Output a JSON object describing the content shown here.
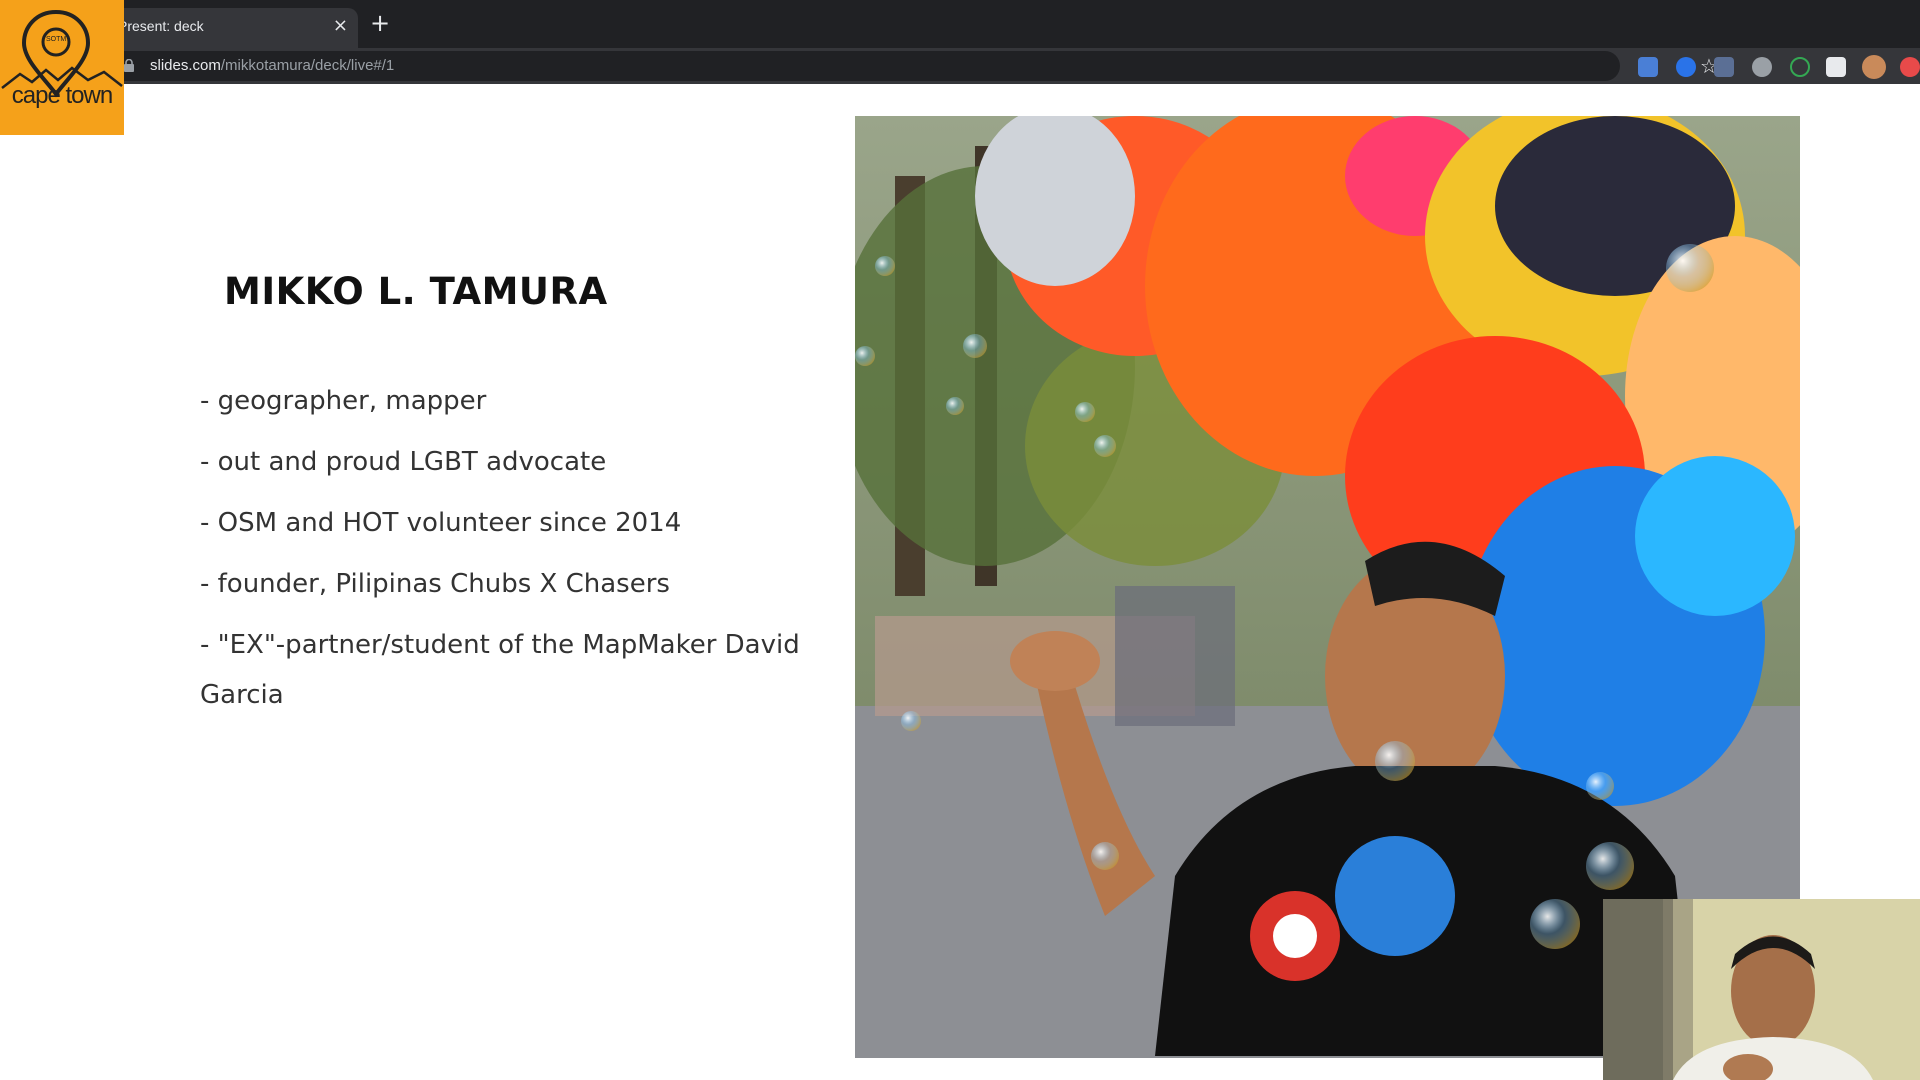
{
  "browser": {
    "tab_title": "Present: deck",
    "tab_close": "×",
    "new_tab": "+",
    "url_domain": "slides.com",
    "url_path": "/mikkotamura/deck/live#/1",
    "bookmark_icon": "star-icon",
    "extensions": [
      "extension-icon",
      "extension-icon",
      "facebook-icon",
      "extension-icon",
      "extension-icon",
      "puzzle-icon",
      "avatar",
      "extension-icon"
    ]
  },
  "logo": {
    "text": "cape town",
    "badge": "SOTM",
    "color": "#f5a11a"
  },
  "slide": {
    "title": "MIKKO L. TAMURA",
    "bullets": [
      "- geographer, mapper",
      "- out and proud LGBT advocate",
      "- OSM and HOT volunteer since 2014",
      "- founder, Pilipinas Chubs X Chasers",
      "- \"EX\"-partner/student of the MapMaker David Garcia"
    ]
  }
}
